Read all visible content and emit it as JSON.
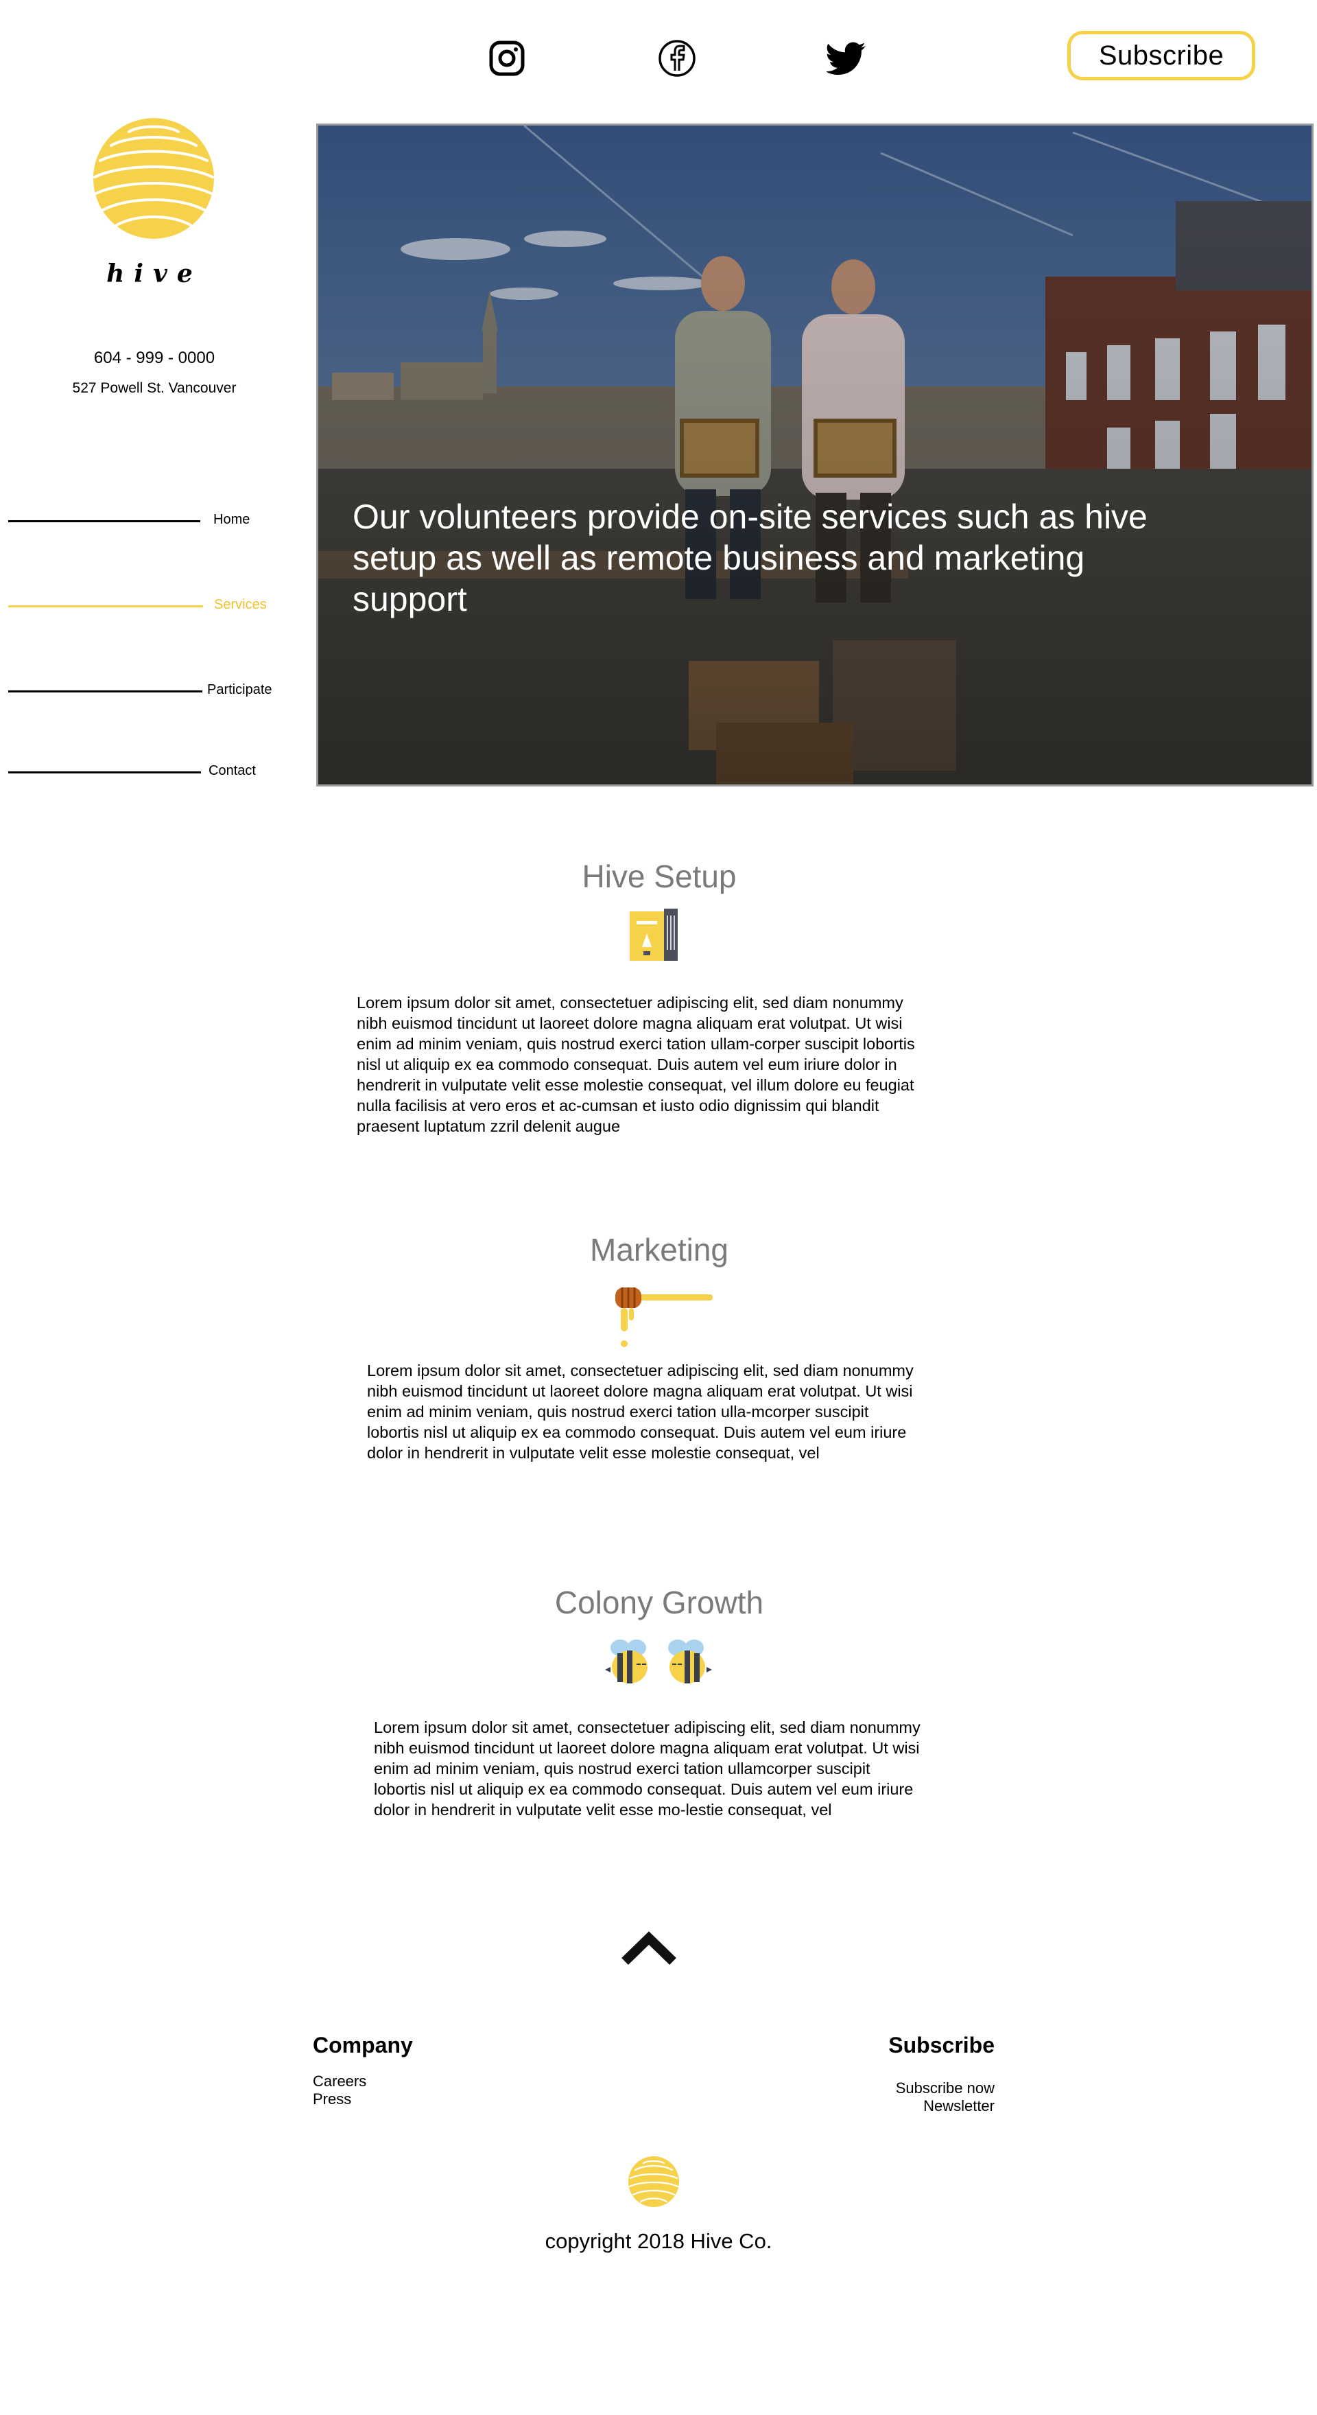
{
  "header": {
    "social": [
      {
        "name": "instagram-icon"
      },
      {
        "name": "facebook-icon"
      },
      {
        "name": "twitter-icon"
      }
    ],
    "subscribe_label": "Subscribe"
  },
  "sidebar": {
    "brand": "hive",
    "phone": "604 - 999 - 0000",
    "address": "527 Powell St. Vancouver",
    "nav": [
      {
        "label": "Home"
      },
      {
        "label": "Services"
      },
      {
        "label": "Participate"
      },
      {
        "label": "Contact"
      }
    ]
  },
  "hero": {
    "caption": "Our volunteers provide on-site services such as hive setup as well as remote business and marketing support"
  },
  "sections": [
    {
      "title": "Hive Setup",
      "icon": "beehive-box-icon",
      "body": "Lorem ipsum dolor sit amet, consectetuer adipiscing elit, sed diam nonummy nibh euismod tincidunt ut laoreet dolore magna aliquam erat volutpat. Ut wisi enim ad minim veniam, quis nostrud exerci tation ullam-corper suscipit lobortis nisl ut aliquip ex ea commodo consequat. Duis autem vel eum iriure dolor in hendrerit in vulputate velit esse molestie consequat, vel illum dolore eu feugiat nulla facilisis at vero eros et ac-cumsan et iusto odio dignissim qui blandit praesent luptatum zzril delenit augue"
    },
    {
      "title": "Marketing",
      "icon": "honey-dipper-icon",
      "body": "Lorem ipsum dolor sit amet, consectetuer adipiscing elit, sed diam nonummy nibh euismod tincidunt ut laoreet dolore magna aliquam erat volutpat. Ut wisi enim ad minim veniam, quis nostrud exerci tation ulla-mcorper suscipit lobortis nisl ut aliquip ex ea commodo consequat. Duis autem vel eum iriure dolor in hendrerit in vulputate velit esse molestie consequat, vel"
    },
    {
      "title": "Colony Growth",
      "icon": "bees-icon",
      "body": "Lorem ipsum dolor sit amet, consectetuer adipiscing elit, sed diam nonummy nibh euismod tincidunt ut laoreet dolore magna aliquam erat volutpat. Ut wisi enim ad minim veniam, quis nostrud exerci tation ullamcorper suscipit lobortis nisl ut aliquip ex ea commodo consequat. Duis autem vel eum iriure dolor in hendrerit in vulputate velit esse mo-lestie consequat, vel"
    }
  ],
  "footer": {
    "company_heading": "Company",
    "company_links": [
      "Careers",
      "Press"
    ],
    "subscribe_heading": "Subscribe",
    "subscribe_links": [
      "Subscribe now",
      "Newsletter"
    ],
    "copyright": "copyright 2018 Hive Co."
  },
  "colors": {
    "accent": "#f6d24a",
    "accent_text": "#f2c12e",
    "heading_gray": "#7a7a7a"
  }
}
